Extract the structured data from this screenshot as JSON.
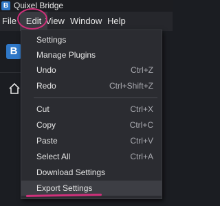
{
  "app": {
    "title": "Quixel Bridge",
    "icon": "B",
    "brand_color": "#2f78c8"
  },
  "menubar": {
    "file": "File",
    "edit": "Edit",
    "view": "View",
    "window": "Window",
    "help": "Help"
  },
  "edit_menu": {
    "items": [
      {
        "label": "Settings",
        "shortcut": ""
      },
      {
        "label": "Manage Plugins",
        "shortcut": ""
      },
      {
        "label": "Undo",
        "shortcut": "Ctrl+Z"
      },
      {
        "label": "Redo",
        "shortcut": "Ctrl+Shift+Z"
      },
      {
        "label": "Cut",
        "shortcut": "Ctrl+X"
      },
      {
        "label": "Copy",
        "shortcut": "Ctrl+C"
      },
      {
        "label": "Paste",
        "shortcut": "Ctrl+V"
      },
      {
        "label": "Select All",
        "shortcut": "Ctrl+A"
      },
      {
        "label": "Download Settings",
        "shortcut": ""
      },
      {
        "label": "Export Settings",
        "shortcut": ""
      }
    ]
  },
  "annotation_color": "#d1307b",
  "icons": {
    "home": "home-icon"
  }
}
